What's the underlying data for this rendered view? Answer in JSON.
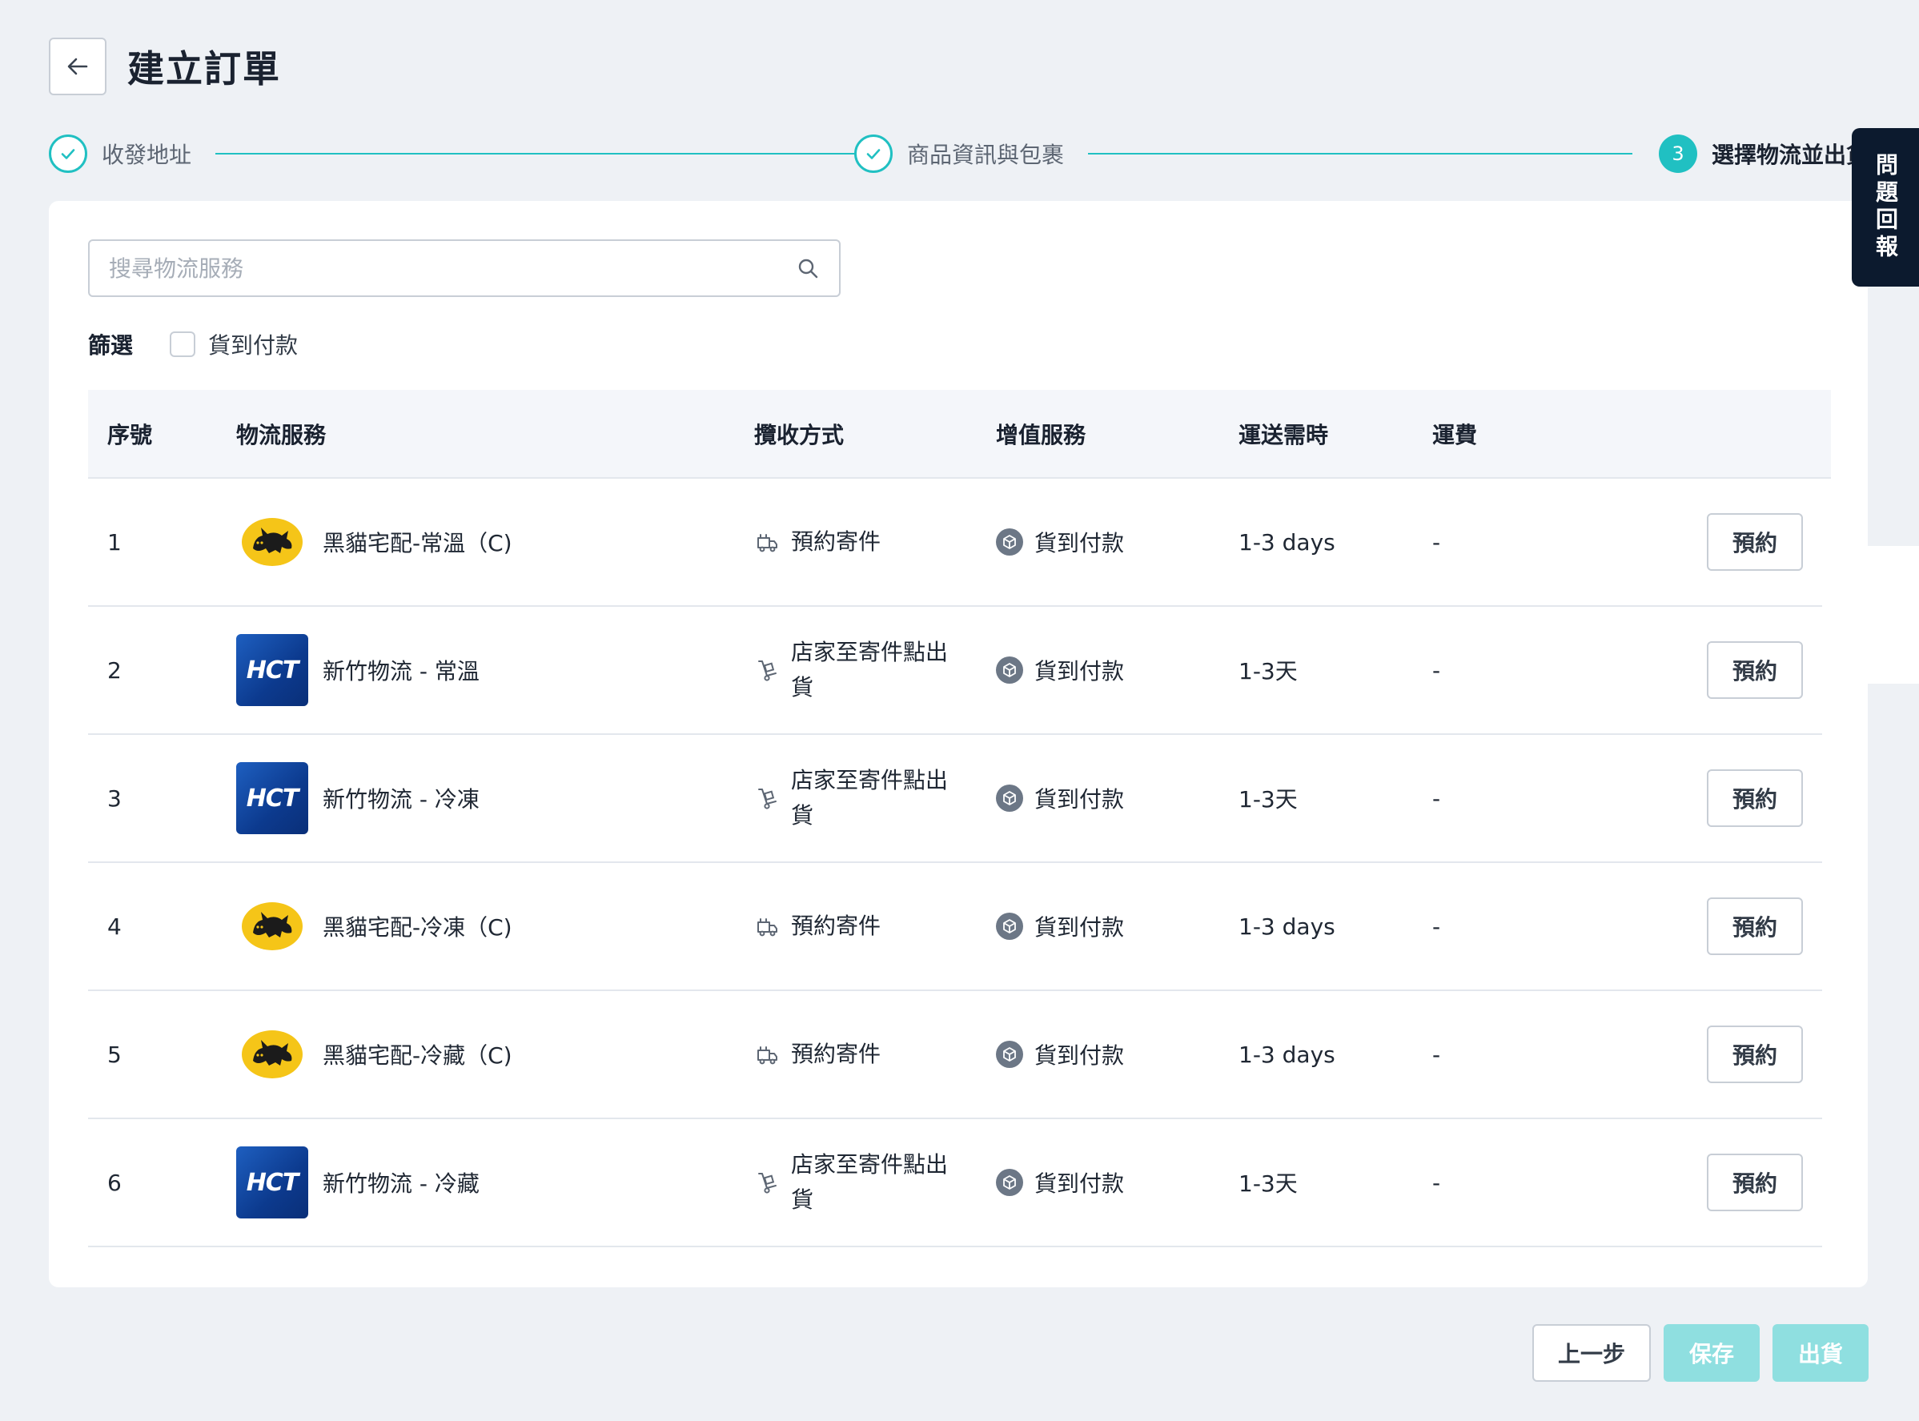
{
  "header": {
    "title": "建立訂單"
  },
  "stepper": {
    "steps": [
      {
        "label": "收發地址",
        "status": "done"
      },
      {
        "label": "商品資訊與包裹",
        "status": "done"
      },
      {
        "label": "選擇物流並出貨",
        "status": "active",
        "number": "3"
      }
    ]
  },
  "feedback": {
    "label": "問題回報"
  },
  "search": {
    "placeholder": "搜尋物流服務",
    "value": ""
  },
  "filter": {
    "label": "篩選",
    "checkbox_label": "貨到付款",
    "checked": false
  },
  "table": {
    "headers": {
      "no": "序號",
      "service": "物流服務",
      "pickup": "攬收方式",
      "vas": "增值服務",
      "time": "運送需時",
      "fee": "運費"
    },
    "rows": [
      {
        "no": "1",
        "logo": "yamato-cat-logo",
        "service": "黑貓宅配-常溫（C)",
        "pickup_icon": "calendar-truck-icon",
        "pickup": "預約寄件",
        "vas": "貨到付款",
        "time": "1-3 days",
        "fee": "-",
        "action": "預約"
      },
      {
        "no": "2",
        "logo": "hct-logo",
        "service": "新竹物流 - 常溫",
        "pickup_icon": "hand-truck-icon",
        "pickup": "店家至寄件點出貨",
        "vas": "貨到付款",
        "time": "1-3天",
        "fee": "-",
        "action": "預約"
      },
      {
        "no": "3",
        "logo": "hct-logo",
        "service": "新竹物流 - 冷凍",
        "pickup_icon": "hand-truck-icon",
        "pickup": "店家至寄件點出貨",
        "vas": "貨到付款",
        "time": "1-3天",
        "fee": "-",
        "action": "預約"
      },
      {
        "no": "4",
        "logo": "yamato-cat-logo",
        "service": "黑貓宅配-冷凍（C)",
        "pickup_icon": "calendar-truck-icon",
        "pickup": "預約寄件",
        "vas": "貨到付款",
        "time": "1-3 days",
        "fee": "-",
        "action": "預約"
      },
      {
        "no": "5",
        "logo": "yamato-cat-logo",
        "service": "黑貓宅配-冷藏（C)",
        "pickup_icon": "calendar-truck-icon",
        "pickup": "預約寄件",
        "vas": "貨到付款",
        "time": "1-3 days",
        "fee": "-",
        "action": "預約"
      },
      {
        "no": "6",
        "logo": "hct-logo",
        "service": "新竹物流 - 冷藏",
        "pickup_icon": "hand-truck-icon",
        "pickup": "店家至寄件點出貨",
        "vas": "貨到付款",
        "time": "1-3天",
        "fee": "-",
        "action": "預約"
      }
    ]
  },
  "footer": {
    "prev_label": "上一步",
    "save_label": "保存",
    "ship_label": "出貨"
  },
  "colors": {
    "accent": "#20c0c2",
    "accent_disabled": "#8fdfe0",
    "feedback_bg": "#0c1a2e",
    "page_bg": "#eef1f5"
  },
  "logo_text": {
    "hct": "HCT"
  }
}
